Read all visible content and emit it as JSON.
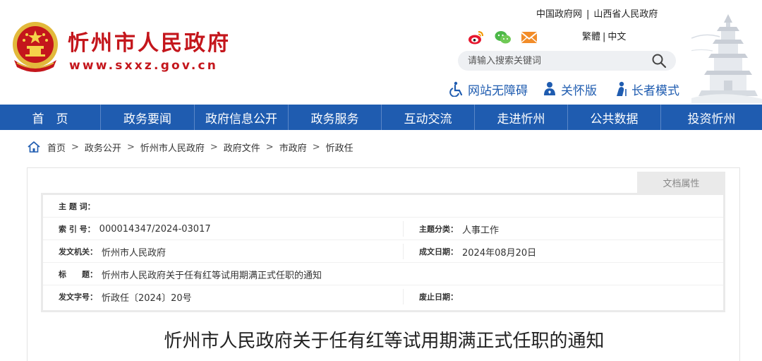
{
  "header": {
    "site_title": "忻州市人民政府",
    "site_domain": "www.sxxz.gov.cn",
    "top_links": [
      "中国政府网",
      "山西省人民政府"
    ],
    "top_links_sep": "|",
    "lang": [
      "繁體",
      "中文"
    ],
    "lang_sep": "|",
    "search_placeholder": "请输入搜索关键词",
    "accessibility": [
      {
        "label": "网站无障碍",
        "icon": "wheelchair-icon"
      },
      {
        "label": "关怀版",
        "icon": "care-icon"
      },
      {
        "label": "长者模式",
        "icon": "elder-icon"
      }
    ],
    "social_icons": [
      "weibo-icon",
      "wechat-icon",
      "email-icon"
    ]
  },
  "nav": {
    "items": [
      "首　页",
      "政务要闻",
      "政府信息公开",
      "政务服务",
      "互动交流",
      "走进忻州",
      "公共数据",
      "投资忻州"
    ]
  },
  "breadcrumb": {
    "items": [
      "首页",
      "政务公开",
      "忻州市人民政府",
      "政府文件",
      "市政府",
      "忻政任"
    ],
    "sep": ">"
  },
  "doc_attr": {
    "tab_label": "文档属性",
    "subject_words_label": "主 题 词：",
    "subject_words_value": "",
    "index_label": "索 引 号：",
    "index_value": "000014347/2024-03017",
    "category_label": "主题分类：",
    "category_value": "人事工作",
    "issuer_label": "发文机关：",
    "issuer_value": "忻州市人民政府",
    "date_label": "成文日期：",
    "date_value": "2024年08月20日",
    "title_label": "标　　题：",
    "title_value": "忻州市人民政府关于任有红等试用期满正式任职的通知",
    "docno_label": "发文字号：",
    "docno_value": "忻政任〔2024〕20号",
    "expire_label": "废止日期：",
    "expire_value": ""
  },
  "document": {
    "title": "忻州市人民政府关于任有红等试用期满正式任职的通知"
  },
  "colors": {
    "brand_red": "#c4161c",
    "nav_blue": "#1f5cb0",
    "accent_blue": "#1f5cb0"
  }
}
